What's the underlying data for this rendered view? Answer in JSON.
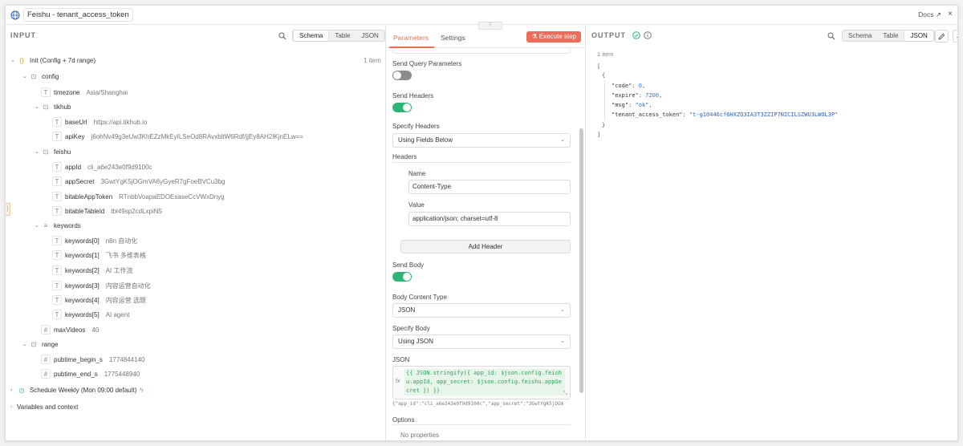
{
  "window": {
    "title": "Feishu - tenant_access_token",
    "docs_label": "Docs",
    "close_label": "×"
  },
  "input": {
    "label": "INPUT",
    "view_tabs": [
      "Schema",
      "Table",
      "JSON"
    ],
    "active_view": "Schema",
    "items_count": "1 item",
    "tree": [
      {
        "key": "Init (Config + 7d range)",
        "value": "",
        "type": "object"
      },
      {
        "key": "config",
        "value": "",
        "type": "object"
      },
      {
        "key": "timezone",
        "value": "Asia/Shanghai",
        "type": "string"
      },
      {
        "key": "tikhub",
        "value": "",
        "type": "object"
      },
      {
        "key": "baseUrl",
        "value": "https://api.tikhub.io",
        "type": "string"
      },
      {
        "key": "apiKey",
        "value": "j6ohNv49g3eUw3KhEZzMkEyILSeOd8RAvxbltW6Rdf/jjEy8AH2IKjnELw==",
        "type": "string"
      },
      {
        "key": "feishu",
        "value": "",
        "type": "object"
      },
      {
        "key": "appId",
        "value": "cli_a6e243e0f9d9100c",
        "type": "string"
      },
      {
        "key": "appSecret",
        "value": "3GwtYgK5jOGmVA6yGyeR7gFoeBVCu3bg",
        "type": "string"
      },
      {
        "key": "bitableAppToken",
        "value": "RTnbbVoapaEDOEsaseCcVWxDnyg",
        "type": "string"
      },
      {
        "key": "bitableTableId",
        "value": "tbl49sp2cdLxpiN5",
        "type": "string"
      },
      {
        "key": "keywords",
        "value": "",
        "type": "array"
      },
      {
        "key": "keywords[0]",
        "value": "n8n 自动化",
        "type": "string"
      },
      {
        "key": "keywords[1]",
        "value": "飞书 多维表格",
        "type": "string"
      },
      {
        "key": "keywords[2]",
        "value": "AI 工作流",
        "type": "string"
      },
      {
        "key": "keywords[3]",
        "value": "内容运营自动化",
        "type": "string"
      },
      {
        "key": "keywords[4]",
        "value": "内容运营 选题",
        "type": "string"
      },
      {
        "key": "keywords[5]",
        "value": "AI agent",
        "type": "string"
      },
      {
        "key": "maxVideos",
        "value": "40",
        "type": "number"
      },
      {
        "key": "range",
        "value": "",
        "type": "object"
      },
      {
        "key": "pubtime_begin_s",
        "value": "1774844140",
        "type": "number"
      },
      {
        "key": "pubtime_end_s",
        "value": "1775448940",
        "type": "number"
      },
      {
        "key": "Schedule Weekly (Mon 09:00 default)",
        "value": "",
        "type": "trigger"
      },
      {
        "key": "Variables and context",
        "value": "",
        "type": "section"
      }
    ]
  },
  "params": {
    "tabs": [
      "Parameters",
      "Settings"
    ],
    "active_tab": "Parameters",
    "execute_label": "Execute step",
    "send_query_label": "Send Query Parameters",
    "send_query_on": false,
    "send_headers_label": "Send Headers",
    "send_headers_on": true,
    "specify_headers_label": "Specify Headers",
    "specify_headers_value": "Using Fields Below",
    "headers_label": "Headers",
    "name_label": "Name",
    "name_value": "Content-Type",
    "value_label": "Value",
    "value_value": "application/json; charset=utf-8",
    "add_header_label": "Add Header",
    "send_body_label": "Send Body",
    "send_body_on": true,
    "body_content_type_label": "Body Content Type",
    "body_content_type_value": "JSON",
    "specify_body_label": "Specify Body",
    "specify_body_value": "Using JSON",
    "json_label": "JSON",
    "json_expression": "{{ JSON.stringify({ app_id: $json.config.feishu.appId, app_secret: $json.config.feishu.appSecret }) }}",
    "json_preview": "{\"app_id\":\"cli_a6e243e0f9d9100c\",\"app_secret\":\"3GwtYgK5jOGm",
    "options_label": "Options",
    "no_properties_label": "No properties",
    "fx_label": "fx",
    "drag_handle": "⠿"
  },
  "output": {
    "label": "OUTPUT",
    "items_count": "1 item",
    "view_tabs": [
      "Schema",
      "Table",
      "JSON"
    ],
    "active_view": "JSON",
    "json_lines": [
      {
        "text": "["
      },
      {
        "text": "  {"
      },
      {
        "key": "\"code\"",
        "value": "0",
        "kind": "num"
      },
      {
        "key": "\"expire\"",
        "value": "7200",
        "kind": "num"
      },
      {
        "key": "\"msg\"",
        "value": "\"ok\"",
        "kind": "str"
      },
      {
        "key": "\"tenant_access_token\"",
        "value": "\"t-g10446cf6HXZQ3IA3T3ZZIP7NICILSZWU3LWOL3P\"",
        "kind": "str"
      },
      {
        "text": "  }"
      },
      {
        "text": "]"
      }
    ]
  },
  "colors": {
    "accent": "#e8704e",
    "execute_bg": "#ec6d5a",
    "toggle_on": "#2bb673",
    "toggle_off": "#8c8c8c",
    "success": "#2bb673"
  }
}
